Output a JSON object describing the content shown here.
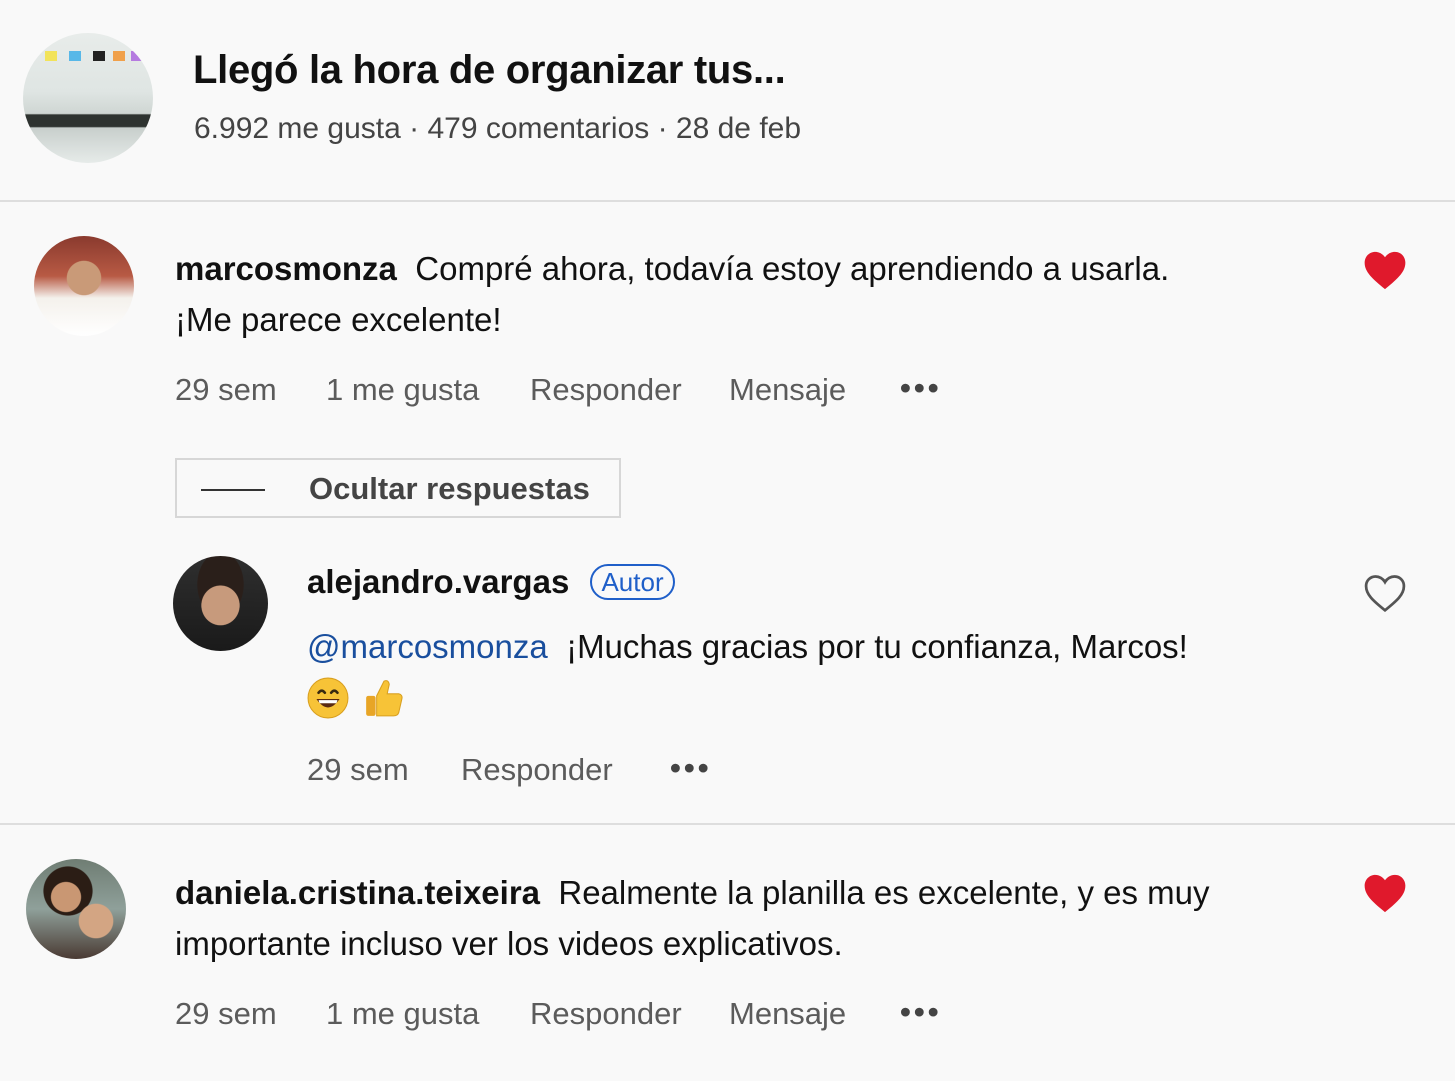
{
  "post": {
    "title": "Llegó la hora de organizar tus...",
    "meta": "6.992 me gusta · 479 comentarios · 28 de feb"
  },
  "comments": [
    {
      "username": "marcosmonza",
      "text_first": "Compré ahora, todavía estoy aprendiendo a usarla.",
      "text_second": "¡Me parece excelente!",
      "time": "29 sem",
      "likes": "1 me gusta",
      "reply": "Responder",
      "message": "Mensaje",
      "more": "•••",
      "liked": true
    },
    {
      "username": "daniela.cristina.teixeira",
      "text_first": "Realmente la planilla es excelente, y es muy",
      "text_second": "importante incluso ver los videos explicativos.",
      "time": "29 sem",
      "likes": "1 me gusta",
      "reply": "Responder",
      "message": "Mensaje",
      "more": "•••",
      "liked": true
    }
  ],
  "replies_toggle": "Ocultar respuestas",
  "reply": {
    "username": "alejandro.vargas",
    "badge": "Autor",
    "mention": "@marcosmonza",
    "text": "¡Muchas gracias por tu confianza, Marcos!",
    "emojis": [
      "grinning-face-emoji",
      "thumbs-up-emoji"
    ],
    "time": "29 sem",
    "reply": "Responder",
    "more": "•••",
    "liked": false
  },
  "colors": {
    "heart_liked": "#e0192c",
    "mention": "#1a4f9e",
    "badge": "#1f5fc9",
    "divider": "#dedede"
  }
}
